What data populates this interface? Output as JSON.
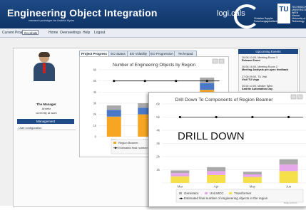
{
  "header": {
    "title": "Engineering Object Integration",
    "subtitle": "research prototype for Andritz Hydro",
    "brand_logics": "logi.cals",
    "cd_lab": "Christian Doppler\nForschungsgesellschaft",
    "tu_logo": "TU",
    "tu_text": "TECHNISCHE UNIVERSITÄT WIEN Vienna University of Technology"
  },
  "nav": {
    "project_label": "Current Project:",
    "project_value": "Boyabat",
    "items": [
      "Home",
      "Overseetings",
      "Help",
      "Logout"
    ]
  },
  "user": {
    "name": "The Manager",
    "org": "Andritz",
    "status": "currently at work",
    "management_title": "Management",
    "links": [
      "User configuration"
    ]
  },
  "tabs": [
    "Project Progress",
    "EO Status",
    "EO Volatility",
    "EO Progression",
    "Techmpad"
  ],
  "events": {
    "title": "Upcoming Events",
    "items": [
      {
        "date": "26.08 10:00, Meeting Room 3",
        "name": "Release Event"
      },
      {
        "date": "26.08 16:00, Meeting Room 2",
        "name": "Meeting Analysis pre-spec feedback"
      },
      {
        "date": "27.08 09:00, TU Visit",
        "name": "Visit TU Vega"
      },
      {
        "date": "30.05 10:00, Master Wien",
        "name": "Andritz Automation Day"
      }
    ]
  },
  "chart_data": [
    {
      "type": "bar",
      "title": "Number of Engineering Objects by Region",
      "categories": [
        "Mar",
        "Apr",
        "May",
        "Jun"
      ],
      "visible_category_labels": [
        "Mar",
        "Apr"
      ],
      "ylim": [
        0,
        6000
      ],
      "ytick_labels": [
        "0",
        "1k",
        "2k",
        "3k",
        "4k",
        "5k",
        "6k"
      ],
      "series": [
        {
          "name": "Region Beamer",
          "color": "#f6a623",
          "values": [
            1800,
            2000,
            1800,
            4200
          ]
        },
        {
          "name": "Region",
          "color": "#4a78c8",
          "values": [
            600,
            600,
            600,
            600
          ]
        },
        {
          "name": "",
          "color": "#a9a9a9",
          "values": [
            400,
            400,
            400,
            500
          ]
        }
      ],
      "estimate_line": {
        "name": "Estimated final number of...",
        "value": 5000
      },
      "legend": [
        "Region Beamer",
        "Region",
        "Estimated final number of..."
      ]
    },
    {
      "type": "bar",
      "title": "Drill Down To Components of Region Beamer",
      "annotation": "DRILL DOWN",
      "categories": [
        "Mar",
        "Apr",
        "May",
        "Jun"
      ],
      "ylim": [
        0,
        6000
      ],
      "ytick_labels": [
        "1k",
        "2k",
        "3k",
        "4k",
        "5k",
        "6k"
      ],
      "series": [
        {
          "name": "Transformer",
          "color": "#f6e04a",
          "values": [
            500,
            600,
            450,
            900
          ]
        },
        {
          "name": "Unit MCC",
          "color": "#e6a8ea",
          "values": [
            250,
            300,
            200,
            500
          ]
        },
        {
          "name": "Generator",
          "color": "#a9a9a9",
          "values": [
            200,
            300,
            200,
            400
          ]
        }
      ],
      "estimate_line": {
        "name": "Estimated final number of engineering objects in the region",
        "value": 5000
      },
      "legend": [
        "Generator",
        "Unit MCC",
        "Transformer",
        "Estimated final number of engineering objects in the region"
      ]
    }
  ],
  "credit": "Radio Icons h..."
}
